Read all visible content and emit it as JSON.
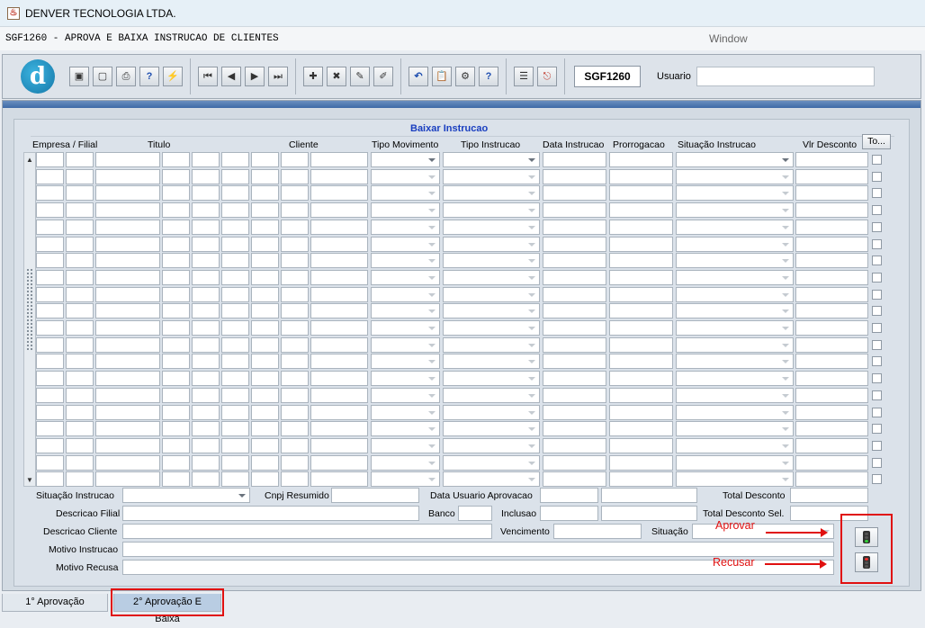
{
  "window": {
    "title": "DENVER TECNOLOGIA LTDA."
  },
  "subtitle": {
    "form_title": "SGF1260 - APROVA E BAIXA INSTRUCAO DE CLIENTES",
    "window_menu": "Window"
  },
  "toolbar": {
    "logo_letter": "d",
    "buttons": [
      {
        "name": "save-icon",
        "glyph": "▣"
      },
      {
        "name": "form-icon",
        "glyph": "▢"
      },
      {
        "name": "print-icon",
        "glyph": "⎙"
      },
      {
        "name": "query-help-icon",
        "glyph": "?"
      },
      {
        "name": "execute-query-icon",
        "glyph": "⚡"
      },
      {
        "name": "first-record-icon",
        "glyph": "⏮"
      },
      {
        "name": "previous-record-icon",
        "glyph": "◀"
      },
      {
        "name": "next-record-icon",
        "glyph": "▶"
      },
      {
        "name": "last-record-icon",
        "glyph": "⏭"
      },
      {
        "name": "insert-record-icon",
        "glyph": "✚"
      },
      {
        "name": "delete-record-icon",
        "glyph": "✖"
      },
      {
        "name": "edit-icon",
        "glyph": "✎"
      },
      {
        "name": "clear-icon",
        "glyph": "✐"
      },
      {
        "name": "undo-icon",
        "glyph": "↶"
      },
      {
        "name": "clipboard-icon",
        "glyph": "📋"
      },
      {
        "name": "tools-icon",
        "glyph": "⚙"
      },
      {
        "name": "help-icon",
        "glyph": "?"
      },
      {
        "name": "menu-icon",
        "glyph": "☰"
      },
      {
        "name": "exit-icon",
        "glyph": "⎋"
      }
    ],
    "form_code": "SGF1260",
    "usuario_label": "Usuario",
    "usuario_value": ""
  },
  "block": {
    "title": "Baixar Instrucao",
    "columns": [
      "Empresa / Filial",
      "Titulo",
      "Cliente",
      "Tipo Movimento",
      "Tipo Instrucao",
      "Data Instrucao",
      "Prorrogacao",
      "Situação Instrucao",
      "Vlr Desconto"
    ],
    "select_all_button": "To...",
    "rows_visible": 20
  },
  "details": {
    "situacao_instrucao_label": "Situação Instrucao",
    "cnpj_resumido_label": "Cnpj Resumido",
    "data_usuario_aprovacao_label": "Data Usuario Aprovacao",
    "total_desconto_label": "Total Desconto",
    "descricao_filial_label": "Descricao Filial",
    "banco_label": "Banco",
    "inclusao_label": "Inclusao",
    "total_desconto_sel_label": "Total Desconto Sel.",
    "descricao_cliente_label": "Descricao Cliente",
    "vencimento_label": "Vencimento",
    "situacao_label": "Situação",
    "motivo_instrucao_label": "Motivo Instrucao",
    "motivo_recusa_label": "Motivo Recusa"
  },
  "annotations": {
    "aprovar": "Aprovar",
    "recusar": "Recusar"
  },
  "tabs": [
    {
      "label": "1° Aprovação",
      "active": false
    },
    {
      "label": "2° Aprovação E Baixa",
      "active": true
    }
  ],
  "colors": {
    "annotation_red": "#e01010",
    "block_title_blue": "#1a3fc0",
    "active_tab": "#b9cde3"
  }
}
